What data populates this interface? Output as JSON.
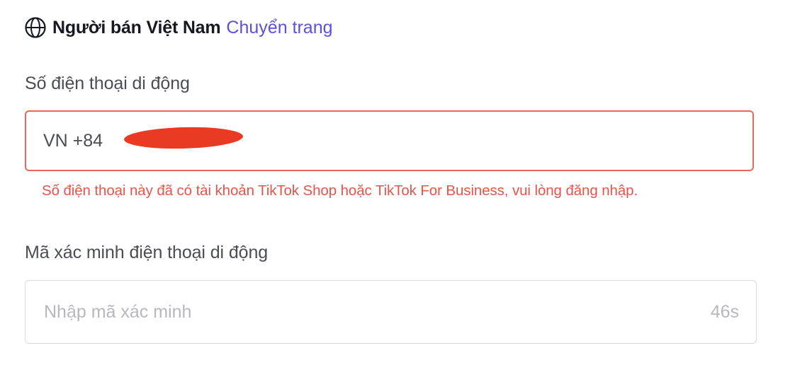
{
  "region": {
    "icon": "globe-icon",
    "label": "Người bán Việt Nam",
    "switch_link": "Chuyển trang",
    "link_color": "#5a50e6"
  },
  "phone": {
    "label": "Số điện thoại di động",
    "country_code": "VN +84",
    "value": "",
    "value_redacted": true,
    "error": "Số điện thoại này đã có tài khoản TikTok Shop hoặc TikTok For Business, vui lòng đăng nhập.",
    "error_color": "#e4554a"
  },
  "verification": {
    "label": "Mã xác minh điện thoại di động",
    "placeholder": "Nhập mã xác minh",
    "countdown": "46s"
  }
}
